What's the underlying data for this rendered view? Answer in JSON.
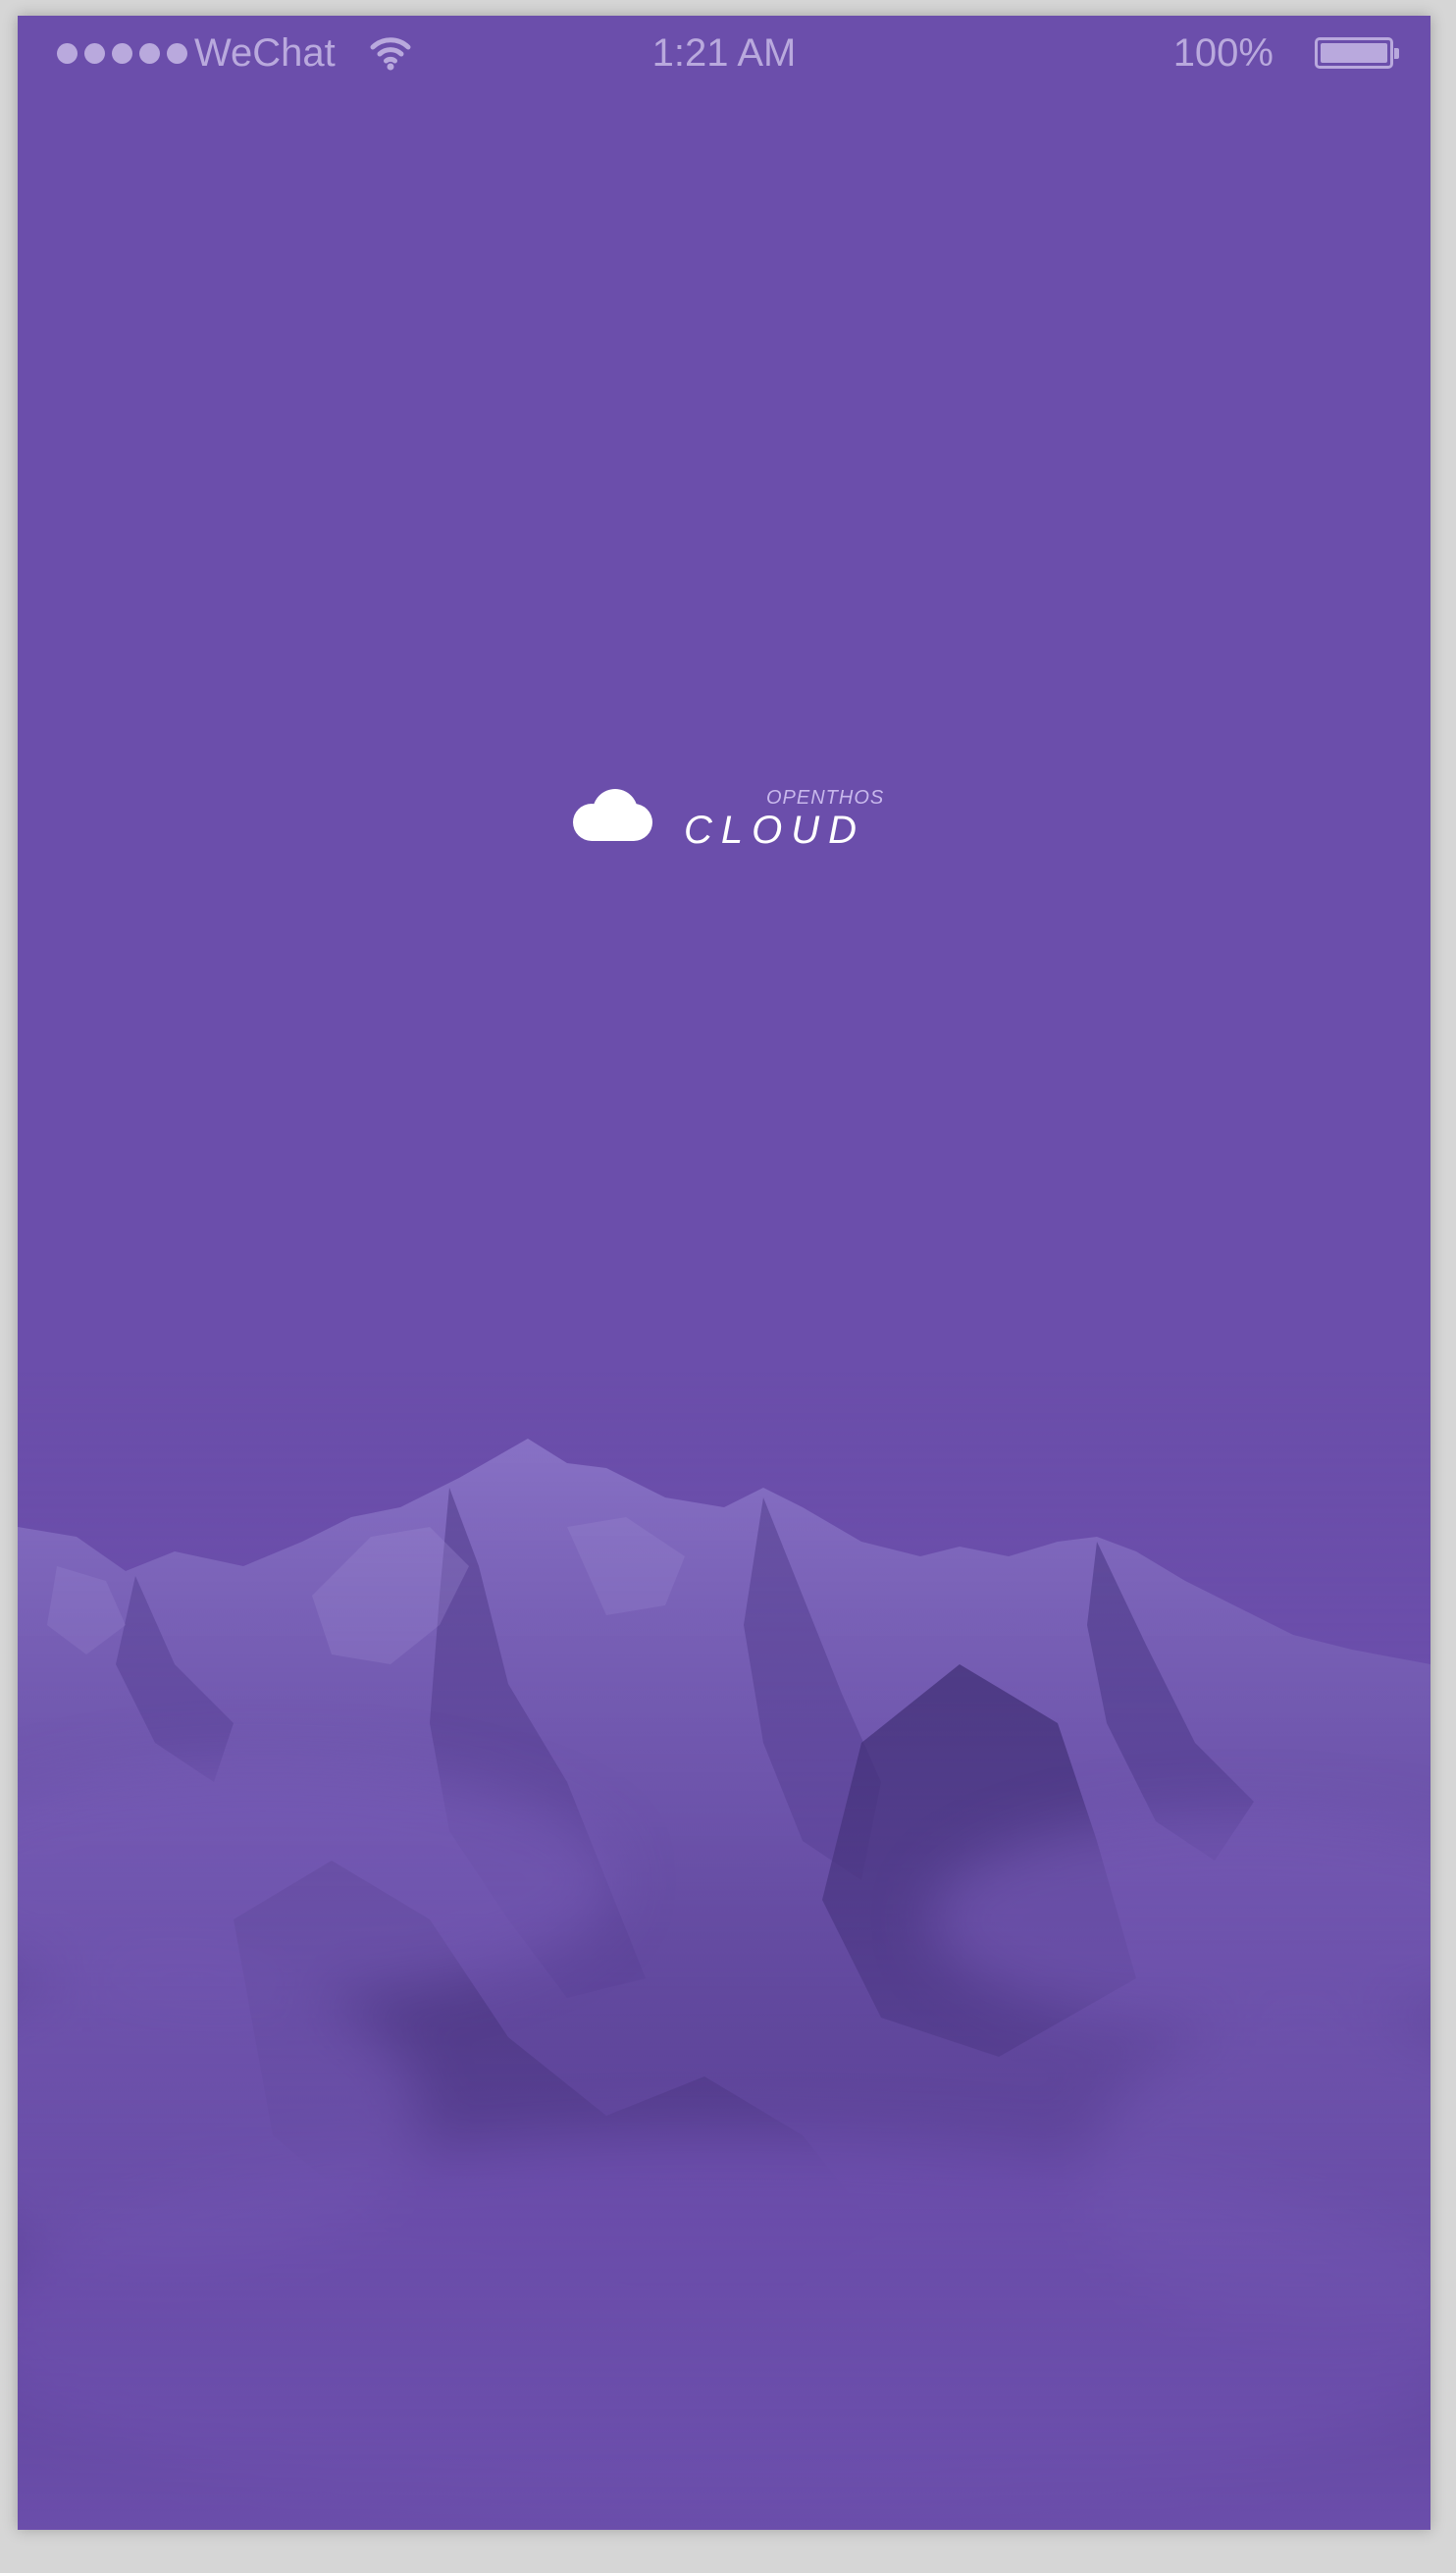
{
  "status_bar": {
    "carrier": "WeChat",
    "time": "1:21 AM",
    "battery_percent": "100%",
    "signal_bars": 5,
    "battery_level": 1.0,
    "wifi_icon": "wifi-icon"
  },
  "splash": {
    "brand_small": "OPENTHOS",
    "brand_name": "CLOUD",
    "logo_icon": "cloud-icon"
  },
  "colors": {
    "background": "#6b4eab",
    "status_text": "#b9a9dd",
    "logo": "#ffffff"
  }
}
